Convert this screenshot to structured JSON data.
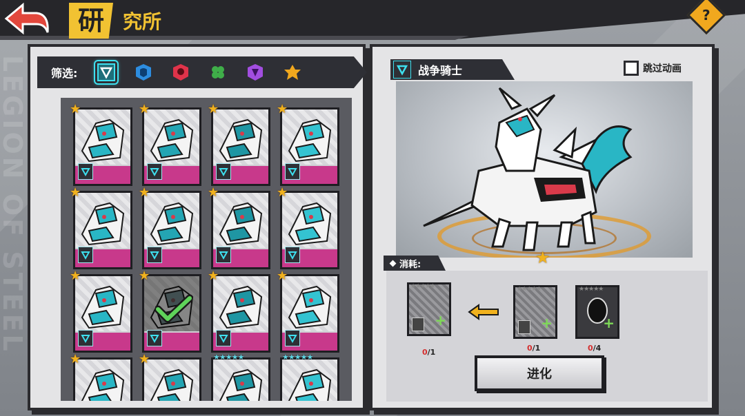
{
  "header": {
    "title_first_char": "研",
    "title_rest": "究所",
    "help_label": "?"
  },
  "background": {
    "side_text": "LEGION OF STEEL"
  },
  "filter": {
    "label": "筛选:",
    "icons": [
      {
        "name": "all-class-icon",
        "color": "#3ee0ef",
        "active": true
      },
      {
        "name": "blue-class-icon",
        "color": "#2d8de0",
        "active": false
      },
      {
        "name": "red-class-icon",
        "color": "#e0334a",
        "active": false
      },
      {
        "name": "green-clover-icon",
        "color": "#3fae49",
        "active": false
      },
      {
        "name": "purple-class-icon",
        "color": "#a24ee0",
        "active": false
      },
      {
        "name": "orange-class-icon",
        "color": "#f1a81e",
        "active": false
      }
    ]
  },
  "cards": [
    {
      "stars": 1,
      "state": "normal"
    },
    {
      "stars": 1,
      "state": "normal"
    },
    {
      "stars": 1,
      "state": "normal"
    },
    {
      "stars": 1,
      "state": "normal"
    },
    {
      "stars": 1,
      "state": "normal"
    },
    {
      "stars": 1,
      "state": "normal"
    },
    {
      "stars": 1,
      "state": "normal"
    },
    {
      "stars": 1,
      "state": "normal"
    },
    {
      "stars": 1,
      "state": "normal"
    },
    {
      "stars": 1,
      "state": "selected"
    },
    {
      "stars": 1,
      "state": "normal"
    },
    {
      "stars": 1,
      "state": "normal"
    },
    {
      "stars": 1,
      "state": "normal"
    },
    {
      "stars": 1,
      "state": "normal"
    },
    {
      "stars": 5,
      "state": "normal"
    },
    {
      "stars": 5,
      "state": "normal"
    }
  ],
  "hero": {
    "name": "战争骑士",
    "skip_animation_label": "跳过动画",
    "stars": 1
  },
  "consume": {
    "label": "消耗:",
    "result": {
      "owned": "0",
      "needed": "/1"
    },
    "materials": [
      {
        "owned": "0",
        "needed": "/1",
        "type": "mech"
      },
      {
        "owned": "0",
        "needed": "/4",
        "type": "silhouette"
      }
    ]
  },
  "evolve_button": "进化",
  "colors": {
    "accent_cyan": "#3ee0ef",
    "accent_yellow": "#f1c232",
    "card_pink": "#c8398b",
    "dark": "#2e2f35"
  }
}
